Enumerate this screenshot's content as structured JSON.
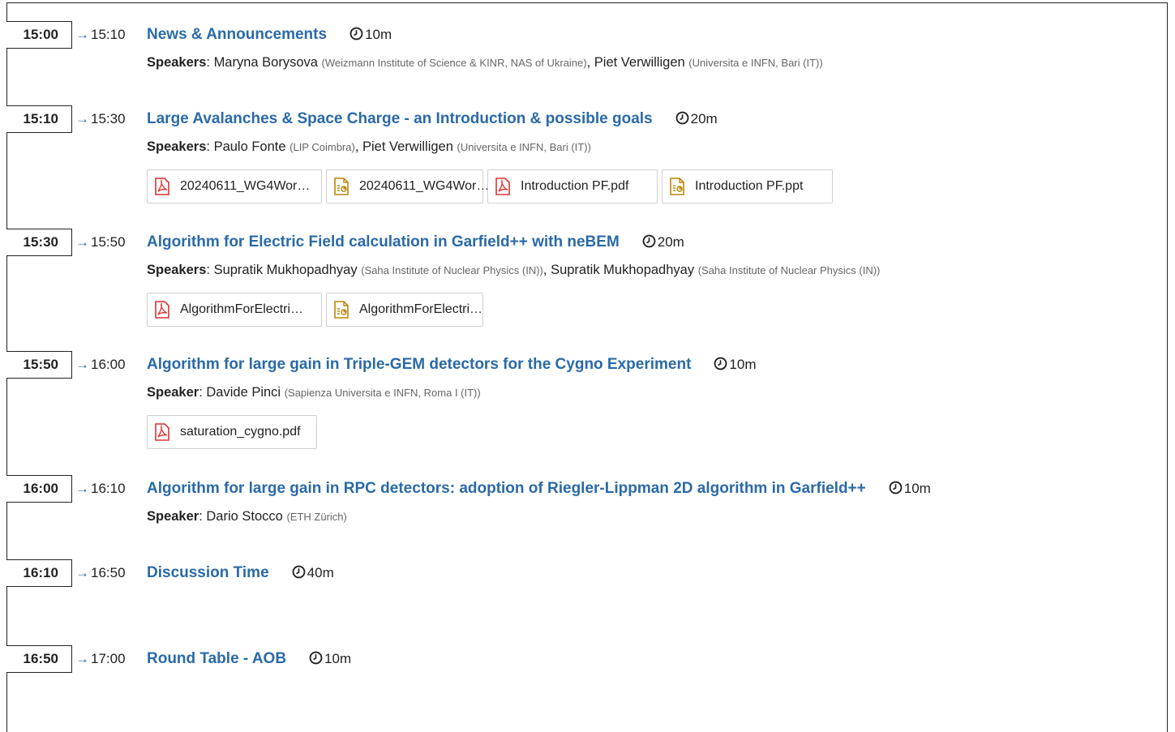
{
  "entries": [
    {
      "start": "15:00",
      "end": "15:10",
      "title": "News & Announcements",
      "duration": "10m",
      "speaker_label": "Speakers",
      "speakers": [
        {
          "name": "Maryna Borysova",
          "affiliation": "(Weizmann Institute of Science & KINR, NAS of Ukraine)"
        },
        {
          "name": "Piet Verwilligen",
          "affiliation": "(Universita e INFN, Bari (IT))"
        }
      ],
      "files": []
    },
    {
      "start": "15:10",
      "end": "15:30",
      "title": "Large Avalanches & Space Charge - an Introduction & possible goals",
      "duration": "20m",
      "speaker_label": "Speakers",
      "speakers": [
        {
          "name": "Paulo Fonte",
          "affiliation": "(LIP Coimbra)"
        },
        {
          "name": "Piet Verwilligen",
          "affiliation": "(Universita e INFN, Bari (IT))"
        }
      ],
      "files": [
        {
          "name": "20240611_WG4Wor…",
          "type": "pdf"
        },
        {
          "name": "20240611_WG4Wor…",
          "type": "ppt"
        },
        {
          "name": "Introduction PF.pdf",
          "type": "pdf"
        },
        {
          "name": "Introduction PF.ppt",
          "type": "ppt"
        }
      ]
    },
    {
      "start": "15:30",
      "end": "15:50",
      "title": "Algorithm for Electric Field calculation in Garfield++ with neBEM",
      "duration": "20m",
      "speaker_label": "Speakers",
      "speakers": [
        {
          "name": "Supratik Mukhopadhyay",
          "affiliation": "(Saha Institute of Nuclear Physics (IN))"
        },
        {
          "name": "Supratik Mukhopadhyay",
          "affiliation": "(Saha Institute of Nuclear Physics (IN))"
        }
      ],
      "files": [
        {
          "name": "AlgorithmForElectri…",
          "type": "pdf"
        },
        {
          "name": "AlgorithmForElectri…",
          "type": "ppt"
        }
      ]
    },
    {
      "start": "15:50",
      "end": "16:00",
      "title": "Algorithm for large gain in Triple-GEM detectors for the Cygno Experiment",
      "duration": "10m",
      "speaker_label": "Speaker",
      "speakers": [
        {
          "name": "Davide Pinci",
          "affiliation": "(Sapienza Universita e INFN, Roma I (IT))"
        }
      ],
      "files": [
        {
          "name": "saturation_cygno.pdf",
          "type": "pdf"
        }
      ]
    },
    {
      "start": "16:00",
      "end": "16:10",
      "title": "Algorithm for large gain in RPC detectors: adoption of Riegler-Lippman 2D algorithm in Garfield++",
      "duration": "10m",
      "speaker_label": "Speaker",
      "speakers": [
        {
          "name": "Dario Stocco",
          "affiliation": "(ETH Zürich)"
        }
      ],
      "files": []
    },
    {
      "start": "16:10",
      "end": "16:50",
      "title": "Discussion Time",
      "duration": "40m",
      "speaker_label": "",
      "speakers": [],
      "files": []
    },
    {
      "start": "16:50",
      "end": "17:00",
      "title": "Round Table - AOB",
      "duration": "10m",
      "speaker_label": "",
      "speakers": [],
      "files": []
    }
  ],
  "colors": {
    "link": "#2a6aa8",
    "pdf": "#e03030",
    "ppt": "#b8860b"
  }
}
